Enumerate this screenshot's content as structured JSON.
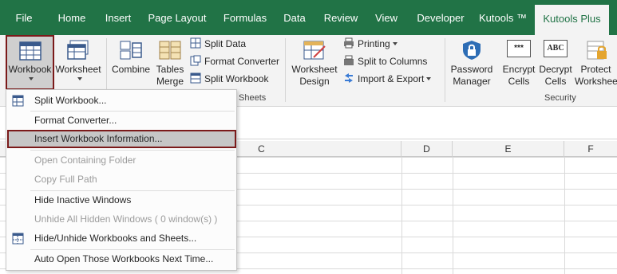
{
  "tabs": [
    "File",
    "Home",
    "Insert",
    "Page Layout",
    "Formulas",
    "Data",
    "Review",
    "View",
    "Developer",
    "Kutools ™",
    "Kutools Plus"
  ],
  "ribbon": {
    "workbook": "Workbook",
    "worksheet": "Worksheet",
    "combine": "Combine",
    "tables_merge_1": "Tables",
    "tables_merge_2": "Merge",
    "split_data": "Split Data",
    "format_converter": "Format Converter",
    "split_workbook": "Split Workbook",
    "group_sheets": "Sheets",
    "worksheet_design_1": "Worksheet",
    "worksheet_design_2": "Design",
    "printing": "Printing",
    "split_to_columns": "Split to Columns",
    "import_export": "Import & Export",
    "password_manager_1": "Password",
    "password_manager_2": "Manager",
    "encrypt_cells_1": "Encrypt",
    "encrypt_cells_2": "Cells",
    "decrypt_cells_1": "Decrypt",
    "decrypt_cells_2": "Cells",
    "protect_ws_1": "Protect",
    "protect_ws_2": "Workshee",
    "group_security": "Security",
    "encrypt_icon_text": "***",
    "decrypt_icon_text": "ABC"
  },
  "columns": [
    "C",
    "D",
    "E",
    "F"
  ],
  "menu": [
    {
      "label": "Split Workbook...",
      "disabled": false
    },
    {
      "label": "Format Converter...",
      "disabled": false
    },
    {
      "label": "Insert Workbook Information...",
      "disabled": false,
      "highlighted": true
    },
    {
      "label": "Open Containing Folder",
      "disabled": true
    },
    {
      "label": "Copy Full Path",
      "disabled": true
    },
    {
      "label": "Hide Inactive Windows",
      "disabled": false
    },
    {
      "label": "Unhide All Hidden Windows ( 0 window(s) )",
      "disabled": true
    },
    {
      "label": "Hide/Unhide Workbooks and Sheets...",
      "disabled": false
    },
    {
      "label": "Auto Open Those Workbooks Next Time...",
      "disabled": false
    }
  ],
  "colors": {
    "excel_green": "#217346",
    "highlight_border": "#7b1a1a",
    "ribbon_bg": "#f3f3f3"
  }
}
